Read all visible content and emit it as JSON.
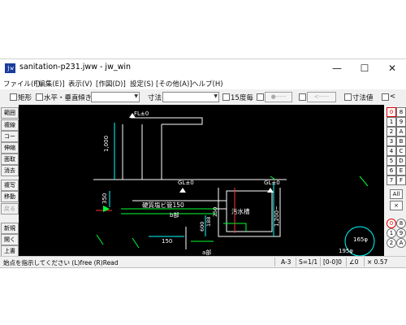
{
  "window": {
    "app_icon": "jw",
    "title": "sanitation-p231.jww - jw_win",
    "minimize": "—",
    "maximize": "☐",
    "close": "✕"
  },
  "menu": [
    "ファイル(F)",
    "[編集(E)]",
    "表示(V)",
    "[作図(D)]",
    "設定(S)",
    "[その他(A)]",
    "ヘルプ(H)"
  ],
  "toolbar": {
    "rect": "矩形",
    "horizontal_vertical": "水平・垂直",
    "slope": "傾き",
    "dimension": "寸法",
    "deg15": "15度毎",
    "circle_btn": "●-----",
    "arrow_btn": "<-----",
    "dim_value": "寸法値",
    "lt": "<"
  },
  "left_tools": [
    "範囲",
    "複線",
    "コーナー",
    "伸縮",
    "面取",
    "消去",
    "複写",
    "移動",
    "戻る",
    "新規",
    "開く",
    "上書"
  ],
  "right_layers": [
    "0",
    "1",
    "2",
    "3",
    "4",
    "5",
    "6",
    "7",
    "8",
    "9",
    "A",
    "B",
    "C",
    "D",
    "E",
    "F",
    "All",
    "×"
  ],
  "drawing": {
    "fl": "FL±0",
    "dim_1000": "1,000",
    "dim_350": "350",
    "gl_left": "GL±0",
    "gl_right": "GL±0",
    "pipe_label": "硬質塩ビ管150",
    "b_part": "b部",
    "tank": "汚水槽",
    "dim_600": "600",
    "dim_188": "188",
    "dim_250": "250",
    "dim_1200": "1,200~",
    "dim_150": "150",
    "a_part": "a部",
    "phi165": "165φ",
    "phi195": "195φ"
  },
  "status": {
    "message": "始点を指示してください (L)free (R)Read",
    "paper": "A-3",
    "scale": "S=1/1",
    "layer": "[0-0]0",
    "angle": "∠0",
    "zoom": "× 0.57"
  }
}
